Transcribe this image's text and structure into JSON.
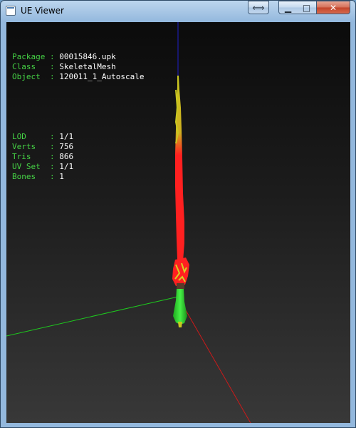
{
  "window": {
    "title": "UE Viewer",
    "controls": {
      "resize_glyph": "⟺",
      "minimize_glyph": "▁",
      "maximize_glyph": "□",
      "close_glyph": "✕"
    }
  },
  "info": {
    "rows1": [
      {
        "label": "Package",
        "sep": " : ",
        "value": "00015846.upk"
      },
      {
        "label": "Class  ",
        "sep": " : ",
        "value": "SkeletalMesh"
      },
      {
        "label": "Object ",
        "sep": " : ",
        "value": "120011_1_Autoscale"
      }
    ],
    "rows2": [
      {
        "label": "LOD    ",
        "sep": " : ",
        "value": "1/1"
      },
      {
        "label": "Verts  ",
        "sep": " : ",
        "value": "756"
      },
      {
        "label": "Tris   ",
        "sep": " : ",
        "value": "866"
      },
      {
        "label": "UV Set ",
        "sep": " : ",
        "value": "1/1"
      },
      {
        "label": "Bones  ",
        "sep": " : ",
        "value": "1"
      }
    ]
  },
  "colors": {
    "info_label": "#45d245",
    "info_value": "#ffffff",
    "axis_x": "#cc1a1a",
    "axis_y": "#1ec81e",
    "axis_z": "#1e1ec8",
    "mesh_red": "#ff2020",
    "mesh_yellow": "#c8c820",
    "mesh_green": "#30e030"
  }
}
